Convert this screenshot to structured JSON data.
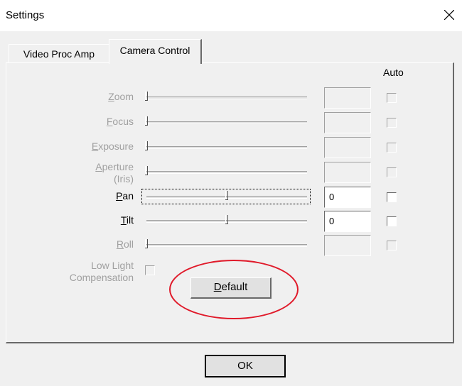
{
  "window": {
    "title": "Settings",
    "close_symbol": "×"
  },
  "tabs": [
    {
      "label": "Video Proc Amp",
      "selected": false
    },
    {
      "label": "Camera Control",
      "selected": true
    }
  ],
  "auto_header": "Auto",
  "controls": [
    {
      "pre": "",
      "hot": "Z",
      "post": "oom",
      "line2": "",
      "enabled": false,
      "value": "",
      "slider_pos": 0.0,
      "auto_checked": false
    },
    {
      "pre": "",
      "hot": "F",
      "post": "ocus",
      "line2": "",
      "enabled": false,
      "value": "",
      "slider_pos": 0.0,
      "auto_checked": false
    },
    {
      "pre": "",
      "hot": "E",
      "post": "xposure",
      "line2": "",
      "enabled": false,
      "value": "",
      "slider_pos": 0.0,
      "auto_checked": false
    },
    {
      "pre": "",
      "hot": "A",
      "post": "perture",
      "line2": "(Iris)",
      "enabled": false,
      "value": "",
      "slider_pos": 0.0,
      "auto_checked": false
    },
    {
      "pre": "",
      "hot": "P",
      "post": "an",
      "line2": "",
      "enabled": true,
      "value": "0",
      "slider_pos": 0.5,
      "auto_checked": false,
      "focused": true
    },
    {
      "pre": "",
      "hot": "T",
      "post": "ilt",
      "line2": "",
      "enabled": true,
      "value": "0",
      "slider_pos": 0.5,
      "auto_checked": false
    },
    {
      "pre": "",
      "hot": "R",
      "post": "oll",
      "line2": "",
      "enabled": false,
      "value": "",
      "slider_pos": 0.0,
      "auto_checked": false
    }
  ],
  "low_light": {
    "line1": "Low Light",
    "line2": "Compensation",
    "enabled": false,
    "checked": false
  },
  "buttons": {
    "default": {
      "hot": "D",
      "rest": "efault"
    },
    "ok": "OK"
  },
  "annotation": {
    "shape": "oval",
    "color": "#e01a2a",
    "target": "default-button"
  },
  "icons": {
    "close": "close-icon"
  }
}
